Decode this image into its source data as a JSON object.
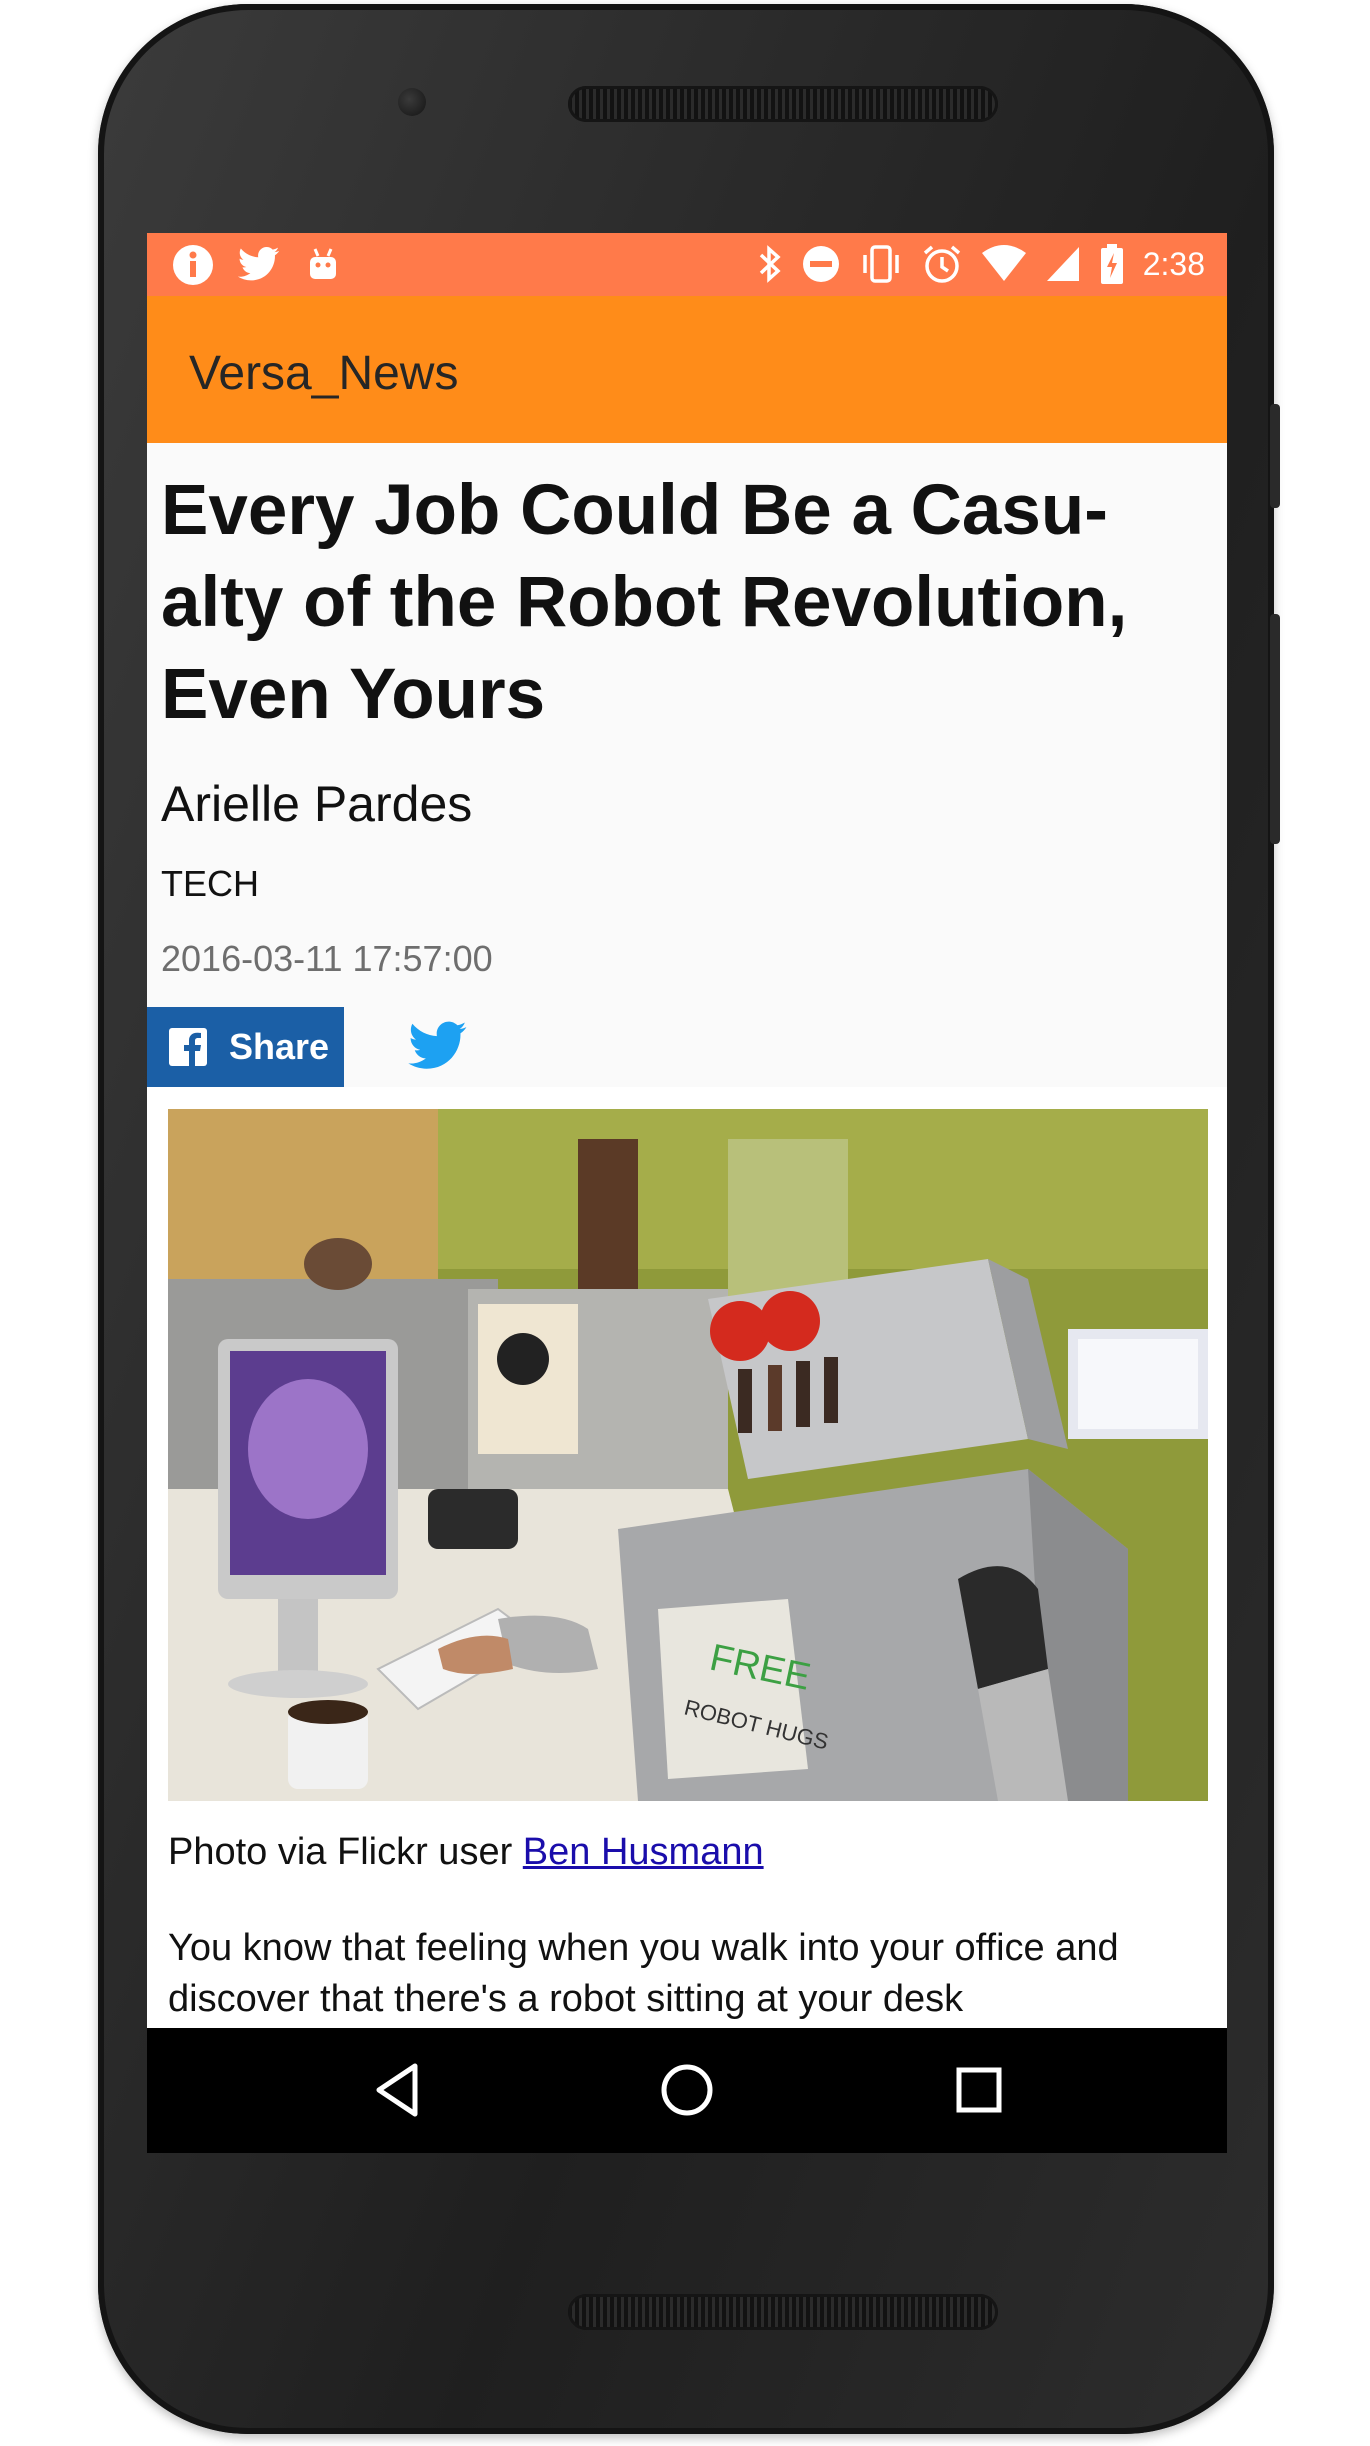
{
  "status_bar": {
    "left_icons": [
      "info-icon",
      "twitter-notification-icon",
      "android-icon"
    ],
    "right_icons": [
      "bluetooth-icon",
      "do-not-disturb-icon",
      "vibrate-icon",
      "alarm-icon",
      "wifi-icon",
      "signal-icon",
      "battery-charging-icon"
    ],
    "time": "2:38"
  },
  "app_bar": {
    "title": "Versa_News"
  },
  "article": {
    "headline": "Every Job Could Be a Casu-alty of the Robot Revolution, Even Yours",
    "author": "Arielle Pardes",
    "category": "TECH",
    "date": "2016-03-11 17:57:00",
    "share": {
      "facebook_label": "Share"
    },
    "caption_prefix": "Photo via Flickr user ",
    "caption_link": "Ben Husmann",
    "body": "You know that feeling when you walk into your office and discover that there's a robot sitting at your desk"
  },
  "photo_text": {
    "sign_line1": "FREE",
    "sign_line2": "ROBOT HUGS"
  },
  "nav_bar": {
    "buttons": [
      "back-icon",
      "home-icon",
      "recents-icon"
    ]
  },
  "colors": {
    "status_bar": "#ff7a4a",
    "app_bar": "#ff8c19",
    "facebook": "#1b5fa6",
    "twitter": "#1da1f2",
    "link": "#1a0dab"
  }
}
